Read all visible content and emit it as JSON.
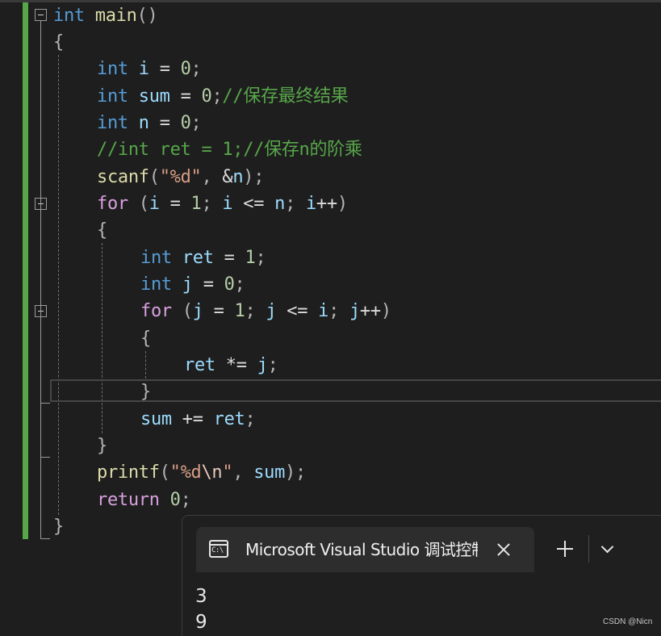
{
  "editor": {
    "lines": [
      [
        [
          "kw",
          "int"
        ],
        [
          "dflt",
          " "
        ],
        [
          "fn",
          "main"
        ],
        [
          "pn",
          "()"
        ]
      ],
      [
        [
          "pn",
          "{"
        ]
      ],
      [
        [
          "kw",
          "int"
        ],
        [
          "dflt",
          " "
        ],
        [
          "var",
          "i"
        ],
        [
          "dflt",
          " = "
        ],
        [
          "num",
          "0"
        ],
        [
          "pn",
          ";"
        ]
      ],
      [
        [
          "kw",
          "int"
        ],
        [
          "dflt",
          " "
        ],
        [
          "var",
          "sum"
        ],
        [
          "dflt",
          " = "
        ],
        [
          "num",
          "0"
        ],
        [
          "pn",
          ";"
        ],
        [
          "cmt",
          "//保存最终结果"
        ]
      ],
      [
        [
          "kw",
          "int"
        ],
        [
          "dflt",
          " "
        ],
        [
          "var",
          "n"
        ],
        [
          "dflt",
          " = "
        ],
        [
          "num",
          "0"
        ],
        [
          "pn",
          ";"
        ]
      ],
      [
        [
          "cmt",
          "//int ret = 1;//保存n的阶乘"
        ]
      ],
      [
        [
          "fn",
          "scanf"
        ],
        [
          "pn",
          "("
        ],
        [
          "str",
          "\"%d\""
        ],
        [
          "pn",
          ", "
        ],
        [
          "dflt",
          "&"
        ],
        [
          "var",
          "n"
        ],
        [
          "pn",
          ");"
        ]
      ],
      [
        [
          "ctl",
          "for"
        ],
        [
          "dflt",
          " "
        ],
        [
          "pn",
          "("
        ],
        [
          "var",
          "i"
        ],
        [
          "dflt",
          " = "
        ],
        [
          "num",
          "1"
        ],
        [
          "pn",
          "; "
        ],
        [
          "var",
          "i"
        ],
        [
          "dflt",
          " <= "
        ],
        [
          "var",
          "n"
        ],
        [
          "pn",
          "; "
        ],
        [
          "var",
          "i"
        ],
        [
          "dflt",
          "++"
        ],
        [
          "pn",
          ")"
        ]
      ],
      [
        [
          "pn",
          "{"
        ]
      ],
      [
        [
          "kw",
          "int"
        ],
        [
          "dflt",
          " "
        ],
        [
          "var",
          "ret"
        ],
        [
          "dflt",
          " = "
        ],
        [
          "num",
          "1"
        ],
        [
          "pn",
          ";"
        ]
      ],
      [
        [
          "kw",
          "int"
        ],
        [
          "dflt",
          " "
        ],
        [
          "var",
          "j"
        ],
        [
          "dflt",
          " = "
        ],
        [
          "num",
          "0"
        ],
        [
          "pn",
          ";"
        ]
      ],
      [
        [
          "ctl",
          "for"
        ],
        [
          "dflt",
          " "
        ],
        [
          "pn",
          "("
        ],
        [
          "var",
          "j"
        ],
        [
          "dflt",
          " = "
        ],
        [
          "num",
          "1"
        ],
        [
          "pn",
          "; "
        ],
        [
          "var",
          "j"
        ],
        [
          "dflt",
          " <= "
        ],
        [
          "var",
          "i"
        ],
        [
          "pn",
          "; "
        ],
        [
          "var",
          "j"
        ],
        [
          "dflt",
          "++"
        ],
        [
          "pn",
          ")"
        ]
      ],
      [
        [
          "pn",
          "{"
        ]
      ],
      [
        [
          "var",
          "ret"
        ],
        [
          "dflt",
          " *= "
        ],
        [
          "var",
          "j"
        ],
        [
          "pn",
          ";"
        ]
      ],
      [
        [
          "pn",
          "}"
        ]
      ],
      [
        [
          "var",
          "sum"
        ],
        [
          "dflt",
          " += "
        ],
        [
          "var",
          "ret"
        ],
        [
          "pn",
          ";"
        ]
      ],
      [
        [
          "pn",
          "}"
        ]
      ],
      [
        [
          "fn",
          "printf"
        ],
        [
          "pn",
          "("
        ],
        [
          "str",
          "\"%d"
        ],
        [
          "esc",
          "\\n"
        ],
        [
          "str",
          "\""
        ],
        [
          "pn",
          ", "
        ],
        [
          "var",
          "sum"
        ],
        [
          "pn",
          ");"
        ]
      ],
      [
        [
          "ctl",
          "return"
        ],
        [
          "dflt",
          " "
        ],
        [
          "num",
          "0"
        ],
        [
          "pn",
          ";"
        ]
      ],
      [
        [
          "pn",
          "}"
        ]
      ]
    ]
  },
  "console": {
    "title": "Microsoft Visual Studio 调试控制台",
    "output": [
      "3",
      "9"
    ]
  },
  "watermark": "CSDN @Nicn"
}
